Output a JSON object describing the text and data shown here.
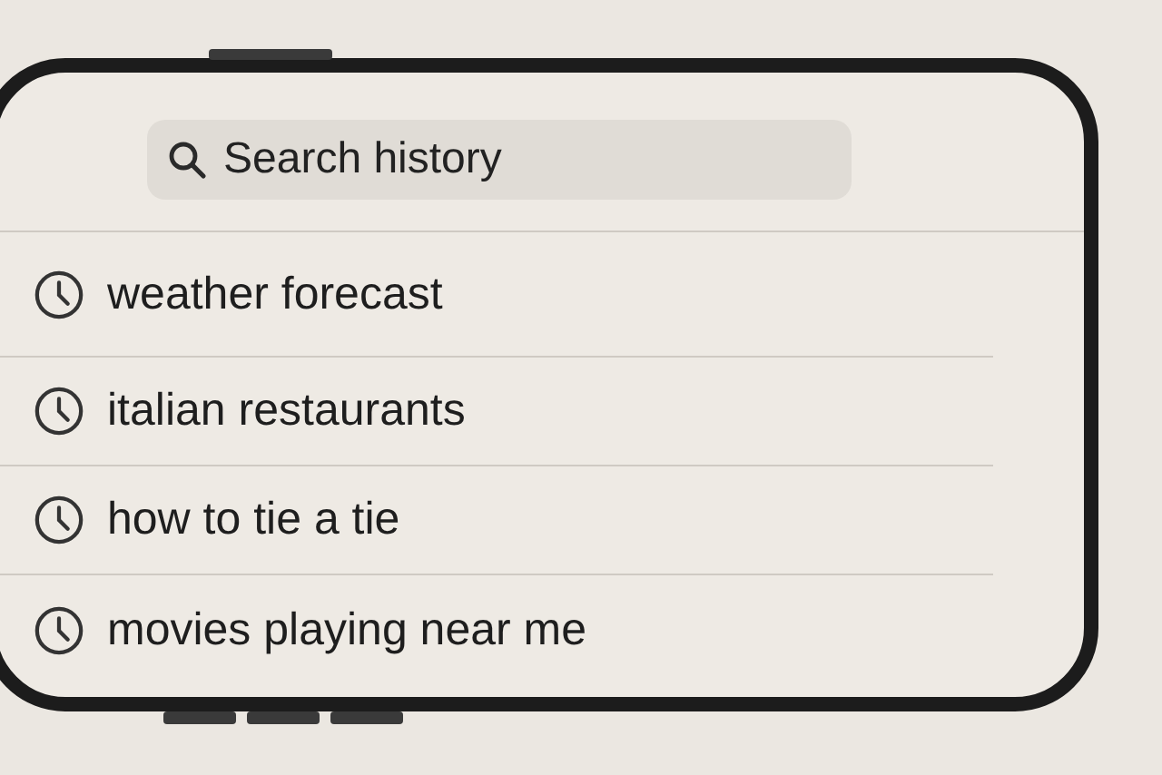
{
  "search": {
    "placeholder": "Search history"
  },
  "history": [
    {
      "text": "weather forecast"
    },
    {
      "text": "italian restaurants"
    },
    {
      "text": "how to tie a tie"
    },
    {
      "text": "movies playing near me"
    }
  ]
}
